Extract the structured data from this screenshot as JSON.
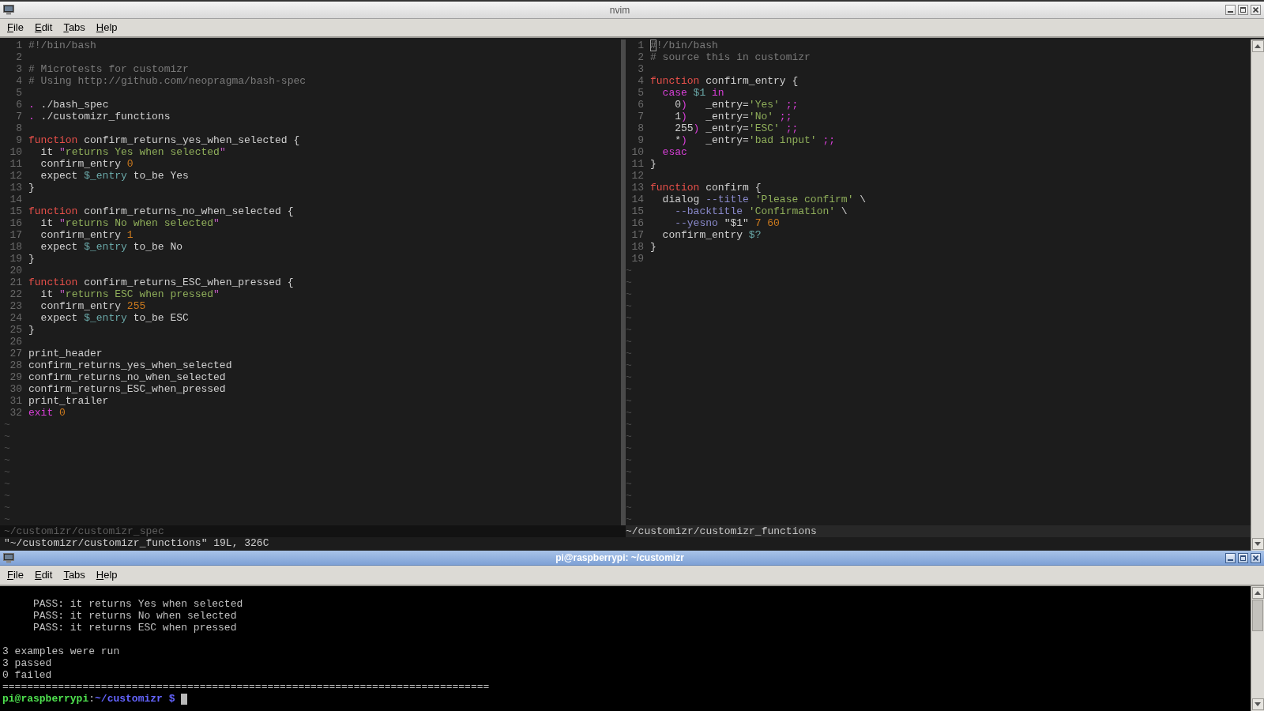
{
  "editor_window": {
    "title": "nvim",
    "active": false,
    "menu": [
      "File",
      "Edit",
      "Tabs",
      "Help"
    ],
    "panes": [
      {
        "active": false,
        "status": "~/customizr/customizr_spec",
        "filler": [
          "~",
          "~",
          "~",
          "~",
          "~",
          "~",
          "~",
          "~",
          "~"
        ],
        "lines": [
          {
            "n": "1",
            "tokens": [
              {
                "kind": "comment",
                "t": "#!/bin/bash"
              }
            ]
          },
          {
            "n": "2"
          },
          {
            "n": "3",
            "tokens": [
              {
                "kind": "comment",
                "t": "# Microtests for customizr"
              }
            ]
          },
          {
            "n": "4",
            "tokens": [
              {
                "kind": "comment",
                "t": "# Using http://github.com/neopragma/bash-spec"
              }
            ]
          },
          {
            "n": "5"
          },
          {
            "n": "6",
            "tokens": [
              {
                "kind": "statement",
                "t": "."
              },
              {
                "kind": "plain",
                "t": " ./bash_spec"
              }
            ]
          },
          {
            "n": "7",
            "tokens": [
              {
                "kind": "statement",
                "t": "."
              },
              {
                "kind": "plain",
                "t": " ./customizr_functions"
              }
            ]
          },
          {
            "n": "8"
          },
          {
            "n": "9",
            "tokens": [
              {
                "kind": "keyword",
                "t": "function"
              },
              {
                "kind": "plain",
                "t": " confirm_returns_yes_when_selected {"
              }
            ]
          },
          {
            "n": "10",
            "tokens": [
              {
                "kind": "plain",
                "t": "  it "
              },
              {
                "kind": "quote",
                "t": "\""
              },
              {
                "kind": "string",
                "t": "returns Yes when selected"
              },
              {
                "kind": "quote",
                "t": "\""
              }
            ]
          },
          {
            "n": "11",
            "tokens": [
              {
                "kind": "plain",
                "t": "  confirm_entry "
              },
              {
                "kind": "number",
                "t": "0"
              }
            ]
          },
          {
            "n": "12",
            "tokens": [
              {
                "kind": "plain",
                "t": "  expect "
              },
              {
                "kind": "variable",
                "t": "$_entry"
              },
              {
                "kind": "plain",
                "t": " to_be Yes"
              }
            ]
          },
          {
            "n": "13",
            "tokens": [
              {
                "kind": "plain",
                "t": "}"
              }
            ]
          },
          {
            "n": "14"
          },
          {
            "n": "15",
            "tokens": [
              {
                "kind": "keyword",
                "t": "function"
              },
              {
                "kind": "plain",
                "t": " confirm_returns_no_when_selected {"
              }
            ]
          },
          {
            "n": "16",
            "tokens": [
              {
                "kind": "plain",
                "t": "  it "
              },
              {
                "kind": "quote",
                "t": "\""
              },
              {
                "kind": "string",
                "t": "returns No when selected"
              },
              {
                "kind": "quote",
                "t": "\""
              }
            ]
          },
          {
            "n": "17",
            "tokens": [
              {
                "kind": "plain",
                "t": "  confirm_entry "
              },
              {
                "kind": "number",
                "t": "1"
              }
            ]
          },
          {
            "n": "18",
            "tokens": [
              {
                "kind": "plain",
                "t": "  expect "
              },
              {
                "kind": "variable",
                "t": "$_entry"
              },
              {
                "kind": "plain",
                "t": " to_be No"
              }
            ]
          },
          {
            "n": "19",
            "tokens": [
              {
                "kind": "plain",
                "t": "}"
              }
            ]
          },
          {
            "n": "20"
          },
          {
            "n": "21",
            "tokens": [
              {
                "kind": "keyword",
                "t": "function"
              },
              {
                "kind": "plain",
                "t": " confirm_returns_ESC_when_pressed {"
              }
            ]
          },
          {
            "n": "22",
            "tokens": [
              {
                "kind": "plain",
                "t": "  it "
              },
              {
                "kind": "quote",
                "t": "\""
              },
              {
                "kind": "string",
                "t": "returns ESC when pressed"
              },
              {
                "kind": "quote",
                "t": "\""
              }
            ]
          },
          {
            "n": "23",
            "tokens": [
              {
                "kind": "plain",
                "t": "  confirm_entry "
              },
              {
                "kind": "number",
                "t": "255"
              }
            ]
          },
          {
            "n": "24",
            "tokens": [
              {
                "kind": "plain",
                "t": "  expect "
              },
              {
                "kind": "variable",
                "t": "$_entry"
              },
              {
                "kind": "plain",
                "t": " to_be ESC"
              }
            ]
          },
          {
            "n": "25",
            "tokens": [
              {
                "kind": "plain",
                "t": "}"
              }
            ]
          },
          {
            "n": "26"
          },
          {
            "n": "27",
            "tokens": [
              {
                "kind": "plain",
                "t": "print_header"
              }
            ]
          },
          {
            "n": "28",
            "tokens": [
              {
                "kind": "plain",
                "t": "confirm_returns_yes_when_selected"
              }
            ]
          },
          {
            "n": "29",
            "tokens": [
              {
                "kind": "plain",
                "t": "confirm_returns_no_when_selected"
              }
            ]
          },
          {
            "n": "30",
            "tokens": [
              {
                "kind": "plain",
                "t": "confirm_returns_ESC_when_pressed"
              }
            ]
          },
          {
            "n": "31",
            "tokens": [
              {
                "kind": "plain",
                "t": "print_trailer"
              }
            ]
          },
          {
            "n": "32",
            "tokens": [
              {
                "kind": "statement",
                "t": "exit"
              },
              {
                "kind": "number",
                "t": " 0"
              }
            ]
          }
        ]
      },
      {
        "active": true,
        "status": "~/customizr/customizr_functions",
        "filler": [
          "~",
          "~",
          "~",
          "~",
          "~",
          "~",
          "~",
          "~",
          "~",
          "~",
          "~",
          "~",
          "~",
          "~",
          "~",
          "~",
          "~",
          "~",
          "~",
          "~",
          "~",
          "~"
        ],
        "lines": [
          {
            "n": "1",
            "tokens": [
              {
                "kind": "comment",
                "t": "#",
                "cursor": true
              },
              {
                "kind": "comment",
                "t": "!/bin/bash"
              }
            ]
          },
          {
            "n": "2",
            "tokens": [
              {
                "kind": "comment",
                "t": "# source this in customizr"
              }
            ]
          },
          {
            "n": "3"
          },
          {
            "n": "4",
            "tokens": [
              {
                "kind": "keyword",
                "t": "function"
              },
              {
                "kind": "plain",
                "t": " confirm_entry {"
              }
            ]
          },
          {
            "n": "5",
            "tokens": [
              {
                "kind": "statement",
                "t": "  case"
              },
              {
                "kind": "variable",
                "t": " $1"
              },
              {
                "kind": "statement",
                "t": " in"
              }
            ]
          },
          {
            "n": "6",
            "tokens": [
              {
                "kind": "plain",
                "t": "    0"
              },
              {
                "kind": "statement",
                "t": ")"
              },
              {
                "kind": "plain",
                "t": "   _entry="
              },
              {
                "kind": "string",
                "t": "'Yes'"
              },
              {
                "kind": "statement",
                "t": " ;;"
              }
            ]
          },
          {
            "n": "7",
            "tokens": [
              {
                "kind": "plain",
                "t": "    1"
              },
              {
                "kind": "statement",
                "t": ")"
              },
              {
                "kind": "plain",
                "t": "   _entry="
              },
              {
                "kind": "string",
                "t": "'No'"
              },
              {
                "kind": "statement",
                "t": " ;;"
              }
            ]
          },
          {
            "n": "8",
            "tokens": [
              {
                "kind": "plain",
                "t": "    255"
              },
              {
                "kind": "statement",
                "t": ")"
              },
              {
                "kind": "plain",
                "t": " _entry="
              },
              {
                "kind": "string",
                "t": "'ESC'"
              },
              {
                "kind": "statement",
                "t": " ;;"
              }
            ]
          },
          {
            "n": "9",
            "tokens": [
              {
                "kind": "plain",
                "t": "    *"
              },
              {
                "kind": "statement",
                "t": ")"
              },
              {
                "kind": "plain",
                "t": "   _entry="
              },
              {
                "kind": "string",
                "t": "'bad input'"
              },
              {
                "kind": "statement",
                "t": " ;;"
              }
            ]
          },
          {
            "n": "10",
            "tokens": [
              {
                "kind": "statement",
                "t": "  esac"
              }
            ]
          },
          {
            "n": "11",
            "tokens": [
              {
                "kind": "plain",
                "t": "}"
              }
            ]
          },
          {
            "n": "12"
          },
          {
            "n": "13",
            "tokens": [
              {
                "kind": "keyword",
                "t": "function"
              },
              {
                "kind": "plain",
                "t": " confirm {"
              }
            ]
          },
          {
            "n": "14",
            "tokens": [
              {
                "kind": "plain",
                "t": "  dialog "
              },
              {
                "kind": "option",
                "t": "--title"
              },
              {
                "kind": "string",
                "t": " 'Please confirm'"
              },
              {
                "kind": "plain",
                "t": " \\"
              }
            ]
          },
          {
            "n": "15",
            "tokens": [
              {
                "kind": "option",
                "t": "    --backtitle"
              },
              {
                "kind": "string",
                "t": " 'Confirmation'"
              },
              {
                "kind": "plain",
                "t": " \\"
              }
            ]
          },
          {
            "n": "16",
            "tokens": [
              {
                "kind": "option",
                "t": "    --yesno"
              },
              {
                "kind": "plain",
                "t": " \"$1\""
              },
              {
                "kind": "number",
                "t": " 7 60"
              }
            ]
          },
          {
            "n": "17",
            "tokens": [
              {
                "kind": "plain",
                "t": "  confirm_entry "
              },
              {
                "kind": "variable",
                "t": "$?"
              }
            ]
          },
          {
            "n": "18",
            "tokens": [
              {
                "kind": "plain",
                "t": "}"
              }
            ]
          },
          {
            "n": "19"
          }
        ]
      }
    ],
    "command_line": "\"~/customizr/customizr_functions\" 19L, 326C"
  },
  "terminal_window": {
    "title": "pi@raspberrypi: ~/customizr",
    "active": true,
    "menu": [
      "File",
      "Edit",
      "Tabs",
      "Help"
    ],
    "output": [
      {
        "kind": "blank"
      },
      {
        "kind": "text",
        "text": "     PASS: it returns Yes when selected"
      },
      {
        "kind": "text",
        "text": "     PASS: it returns No when selected"
      },
      {
        "kind": "text",
        "text": "     PASS: it returns ESC when pressed"
      },
      {
        "kind": "blank"
      },
      {
        "kind": "text",
        "text": "3 examples were run"
      },
      {
        "kind": "text",
        "text": "3 passed"
      },
      {
        "kind": "text",
        "text": "0 failed"
      },
      {
        "kind": "text",
        "text": "==============================================================================="
      }
    ],
    "prompt": [
      {
        "kind": "user",
        "text": "pi@raspberrypi"
      },
      {
        "kind": "separator",
        "text": ":"
      },
      {
        "kind": "path",
        "text": "~/customizr $"
      }
    ]
  }
}
